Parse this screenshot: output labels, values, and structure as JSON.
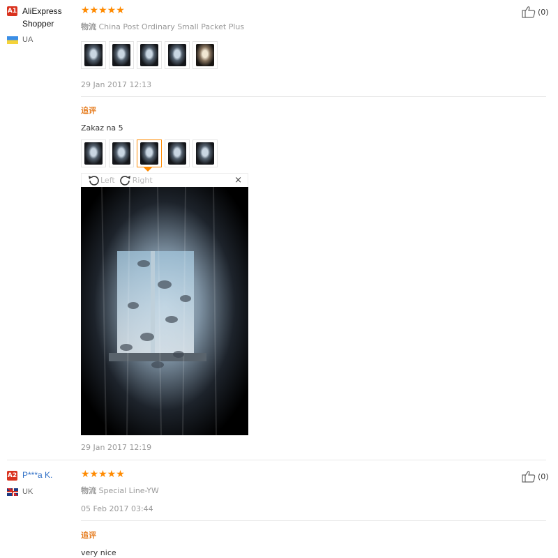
{
  "reviews": [
    {
      "user": {
        "level": "A1",
        "level_color": "#d9321e",
        "name": "AliExpress Shopper",
        "country": "UA"
      },
      "rating": "★★★★★",
      "shipping_label": "物流",
      "shipping": "China Post Ordinary Small Packet Plus",
      "date": "29 Jan 2017 12:13",
      "like_count": "(0)",
      "thumbs": 5,
      "additional": {
        "label": "追评",
        "text": "Zakaz na 5",
        "date": "29 Jan 2017 12:19",
        "viewer": {
          "left_label": "Left",
          "right_label": "Right",
          "close": "×"
        }
      }
    },
    {
      "user": {
        "level": "A2",
        "level_color": "#d9321e",
        "name": "P***a K.",
        "country": "UK"
      },
      "rating": "★★★★★",
      "shipping_label": "物流",
      "shipping": "Special Line-YW",
      "date": "05 Feb 2017 03:44",
      "like_count": "(0)",
      "additional": {
        "label": "追评",
        "text": "very nice"
      }
    }
  ],
  "icons": {
    "like": "thumbs-up-icon",
    "rotate_left": "rotate-left-icon",
    "rotate_right": "rotate-right-icon",
    "close": "close-icon"
  },
  "colors": {
    "star": "#ff8a00",
    "accent_orange": "#e67e22",
    "link_blue": "#2f6fc6"
  }
}
